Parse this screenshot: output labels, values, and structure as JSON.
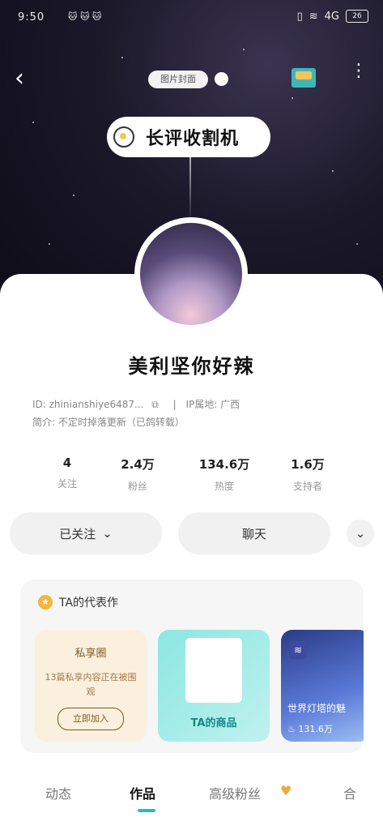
{
  "status_bar": {
    "time": "9:50",
    "cats": "🐱 🐱 🐱",
    "network": "4G",
    "battery": "26"
  },
  "header": {
    "back_label": "‹",
    "cover_label": "图片封面",
    "more_label": "⋮"
  },
  "profile_banner": {
    "title": "长评收割机"
  },
  "user": {
    "nickname": "美利坚你好辣",
    "id_line": "ID: zhinianshiye6487...",
    "ip_line": "IP属地: 广西",
    "bio": "简介: 不定时掉落更新（已鸽转载）"
  },
  "stats": [
    {
      "value": "4",
      "label": "关注"
    },
    {
      "value": "2.4万",
      "label": "粉丝"
    },
    {
      "value": "134.6万",
      "label": "热度"
    },
    {
      "value": "1.6万",
      "label": "支持者"
    }
  ],
  "actions": {
    "follow": "已关注",
    "chat": "聊天"
  },
  "representative": {
    "title": "TA的代表作",
    "tiles": [
      {
        "title": "私享圈",
        "desc": "13篇私享内容正在被围观",
        "button": "立即加入"
      },
      {
        "title": "TA的商品"
      },
      {
        "title": "世界灯塔的魅",
        "count": "131.6万"
      }
    ]
  },
  "tabs": [
    "动态",
    "作品",
    "高级粉丝",
    "合"
  ]
}
